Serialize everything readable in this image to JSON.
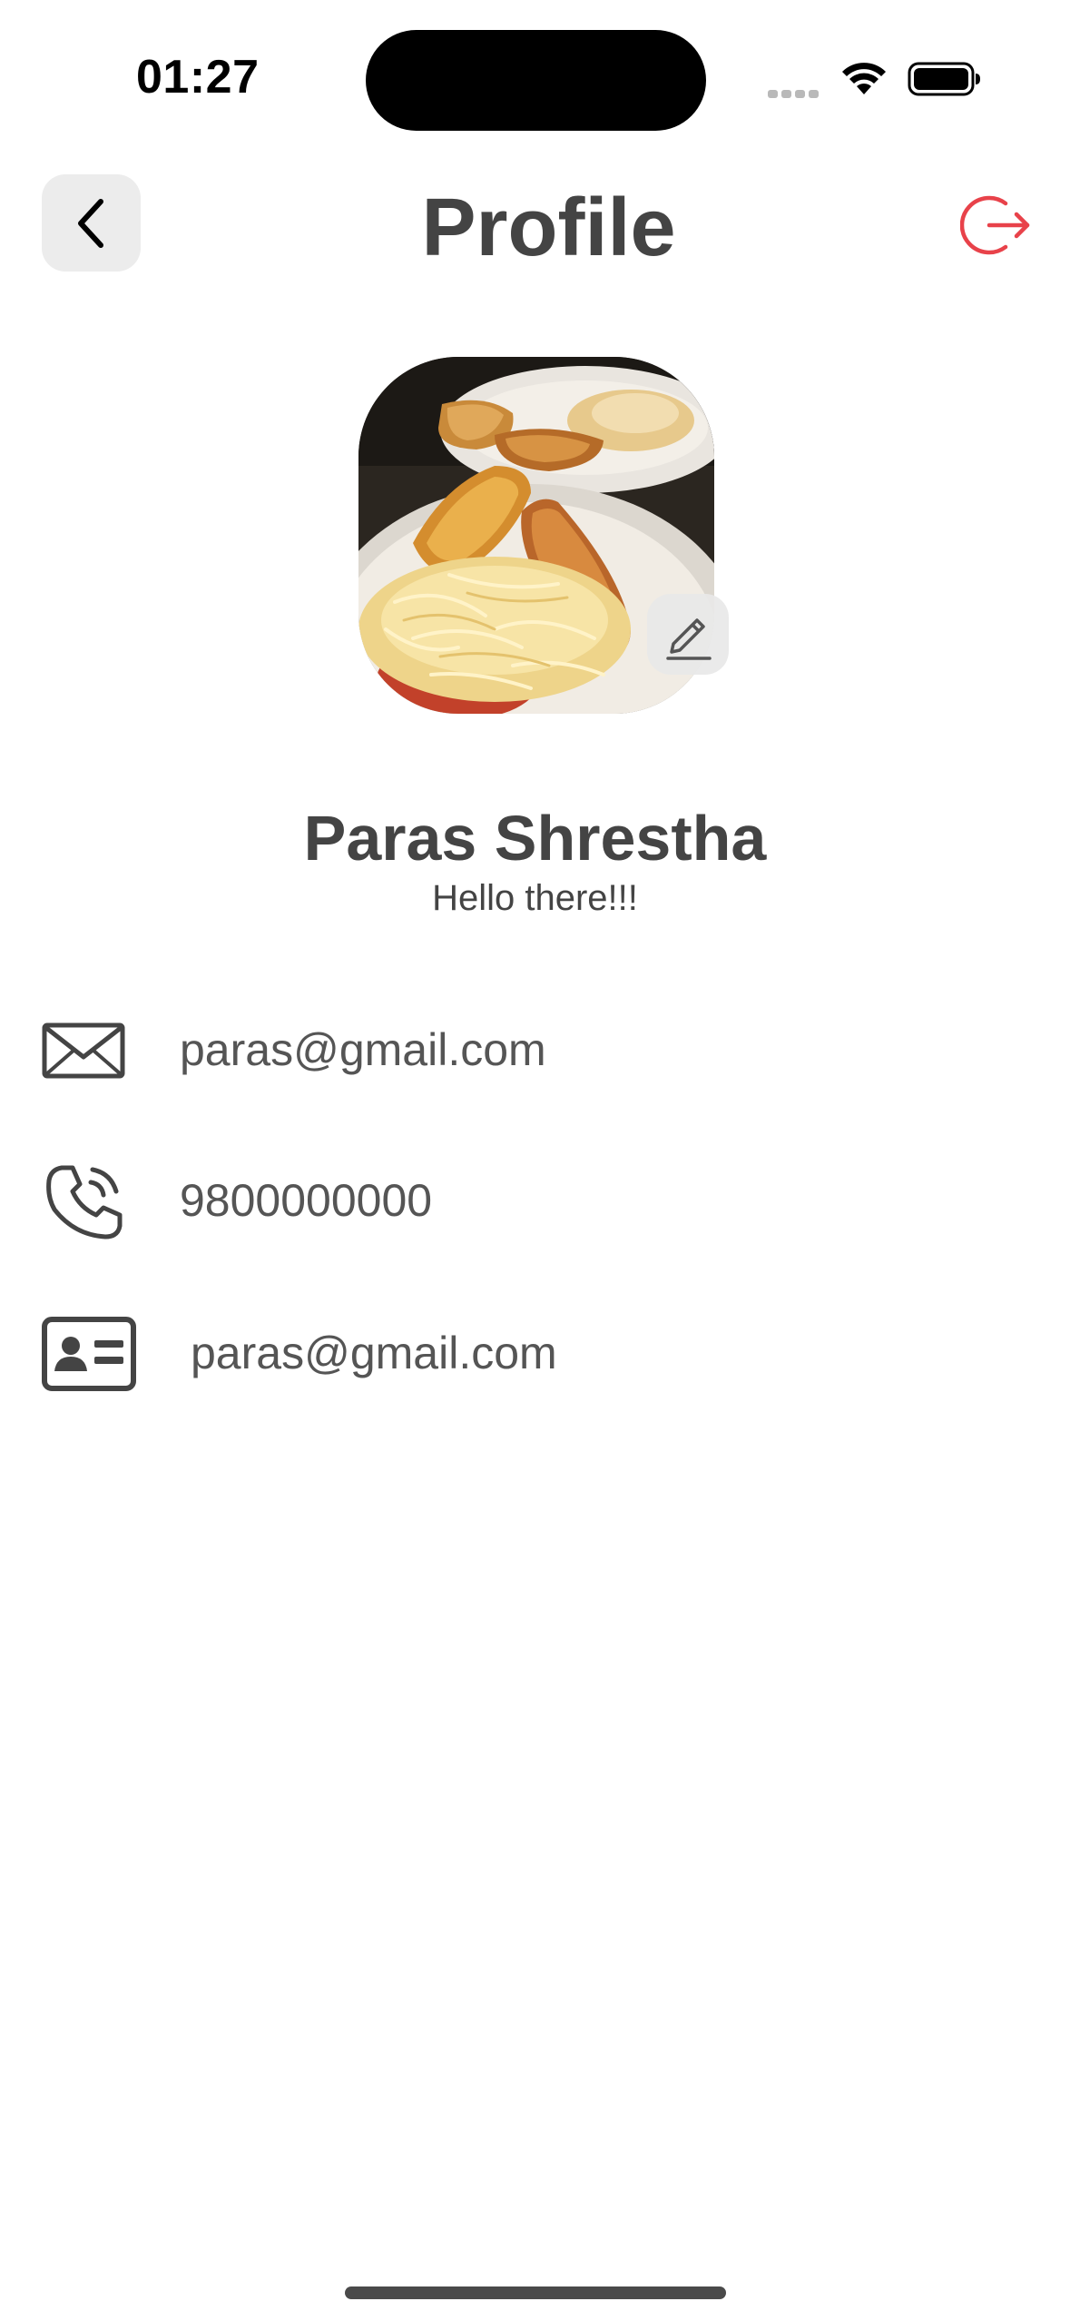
{
  "status_bar": {
    "time": "01:27",
    "icons": [
      "signal-dots-icon",
      "wifi-icon",
      "battery-icon"
    ]
  },
  "header": {
    "title": "Profile",
    "back_icon": "chevron-left-icon",
    "logout_icon": "logout-icon"
  },
  "profile": {
    "avatar_icon": "food-photo",
    "edit_icon": "pencil-icon",
    "name": "Paras Shrestha",
    "bio": "Hello there!!!"
  },
  "info_rows": [
    {
      "icon": "mail-icon",
      "value": "paras@gmail.com"
    },
    {
      "icon": "phone-icon",
      "value": "9800000000"
    },
    {
      "icon": "id-card-icon",
      "value": "paras@gmail.com"
    }
  ],
  "colors": {
    "text": "#444444",
    "accent_logout": "#e8424a",
    "button_bg": "#ececec",
    "background": "#ffffff"
  }
}
